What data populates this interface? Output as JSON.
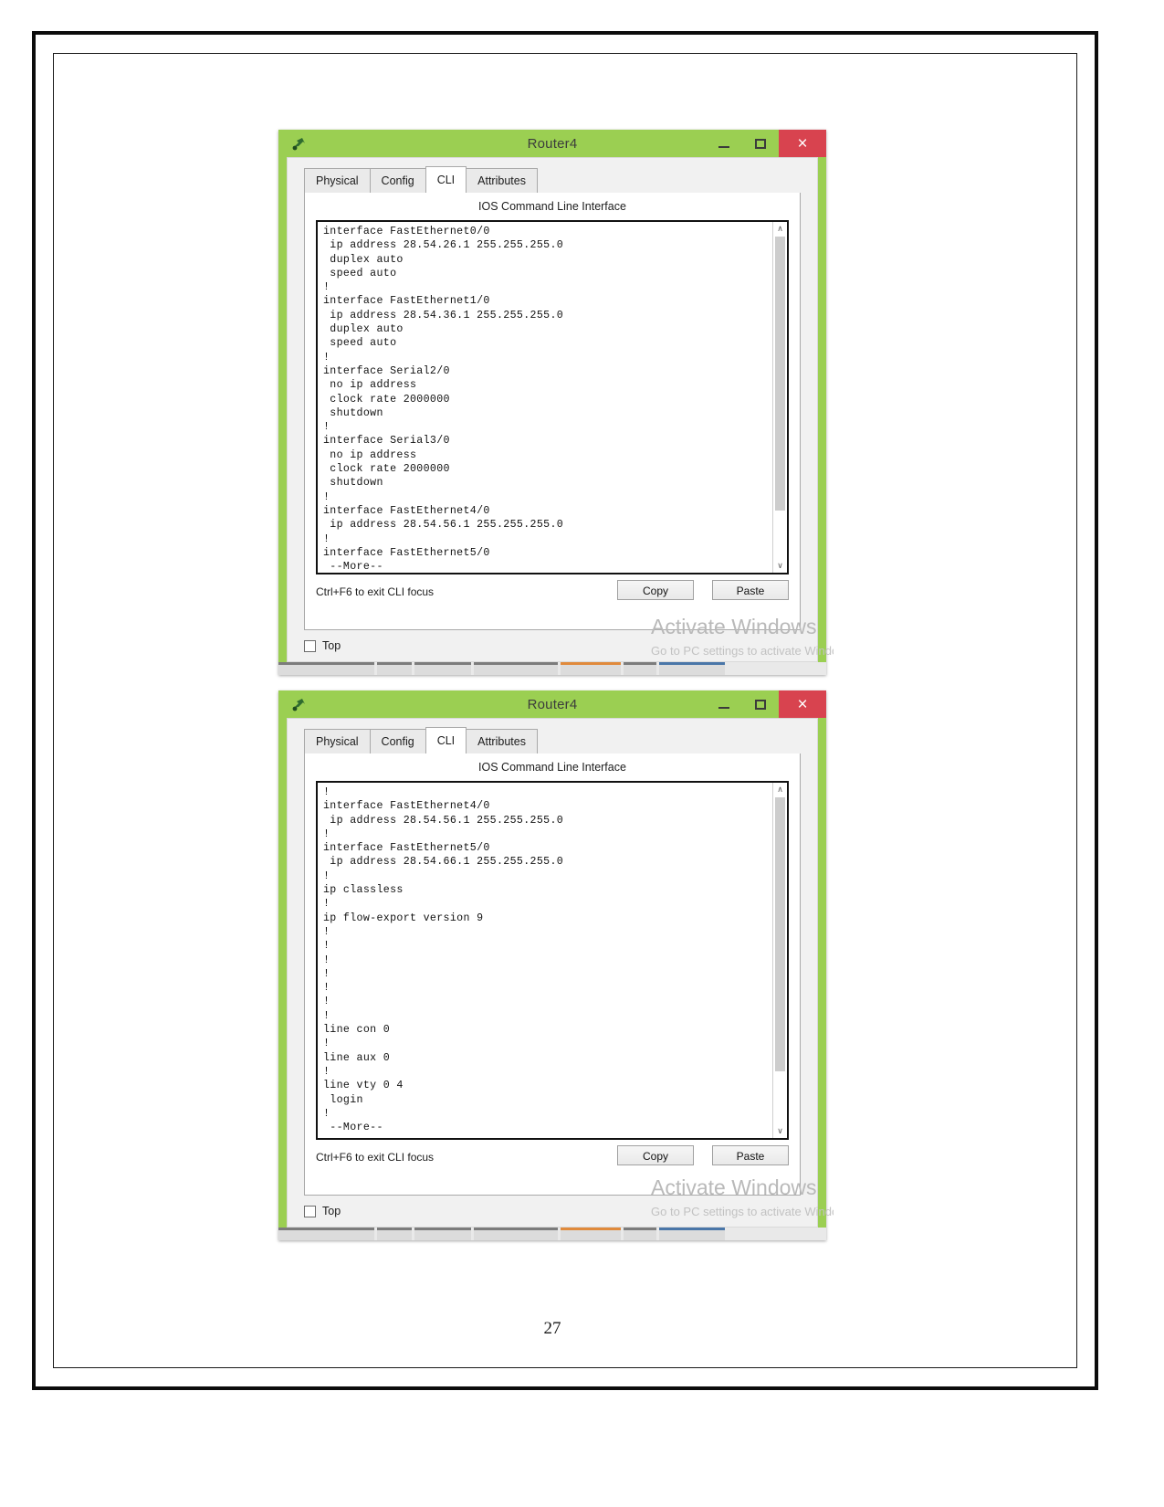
{
  "page": {
    "number": "27"
  },
  "windows": [
    {
      "id": "window-1",
      "title": "Router4",
      "icon": "packet-tracer-router-icon",
      "buttons": {
        "minimize": "–",
        "maximize": "☐",
        "close": "×"
      },
      "tabs": [
        {
          "label": "Physical",
          "active": false
        },
        {
          "label": "Config",
          "active": false
        },
        {
          "label": "CLI",
          "active": true
        },
        {
          "label": "Attributes",
          "active": false
        }
      ],
      "panel_heading": "IOS Command Line Interface",
      "cli_text": "interface FastEthernet0/0\n ip address 28.54.26.1 255.255.255.0\n duplex auto\n speed auto\n!\ninterface FastEthernet1/0\n ip address 28.54.36.1 255.255.255.0\n duplex auto\n speed auto\n!\ninterface Serial2/0\n no ip address\n clock rate 2000000\n shutdown\n!\ninterface Serial3/0\n no ip address\n clock rate 2000000\n shutdown\n!\ninterface FastEthernet4/0\n ip address 28.54.56.1 255.255.255.0\n!\ninterface FastEthernet5/0\n --More--",
      "hint": "Ctrl+F6 to exit CLI focus",
      "copy_label": "Copy",
      "paste_label": "Paste",
      "watermark_title": "Activate Windows",
      "watermark_sub": "Go to PC settings to activate Windows.",
      "checkbox_label": "Top",
      "scroll_up": "∧",
      "scroll_down": "∨"
    },
    {
      "id": "window-2",
      "title": "Router4",
      "icon": "packet-tracer-router-icon",
      "buttons": {
        "minimize": "–",
        "maximize": "☐",
        "close": "×"
      },
      "tabs": [
        {
          "label": "Physical",
          "active": false
        },
        {
          "label": "Config",
          "active": false
        },
        {
          "label": "CLI",
          "active": true
        },
        {
          "label": "Attributes",
          "active": false
        }
      ],
      "panel_heading": "IOS Command Line Interface",
      "cli_text": "!\ninterface FastEthernet4/0\n ip address 28.54.56.1 255.255.255.0\n!\ninterface FastEthernet5/0\n ip address 28.54.66.1 255.255.255.0\n!\nip classless\n!\nip flow-export version 9\n!\n!\n!\n!\n!\n!\n!\nline con 0\n!\nline aux 0\n!\nline vty 0 4\n login\n!\n --More--",
      "hint": "Ctrl+F6 to exit CLI focus",
      "copy_label": "Copy",
      "paste_label": "Paste",
      "watermark_title": "Activate Windows",
      "watermark_sub": "Go to PC settings to activate Windows.",
      "checkbox_label": "Top",
      "scroll_up": "∧",
      "scroll_down": "∨"
    }
  ],
  "colors": {
    "window_chrome": "#9bcf52",
    "close_button": "#d8434f",
    "panel_background": "#f1f1f1",
    "cli_background": "#ffffff",
    "cli_text": "#111111",
    "watermark": "#b9b9b9"
  }
}
